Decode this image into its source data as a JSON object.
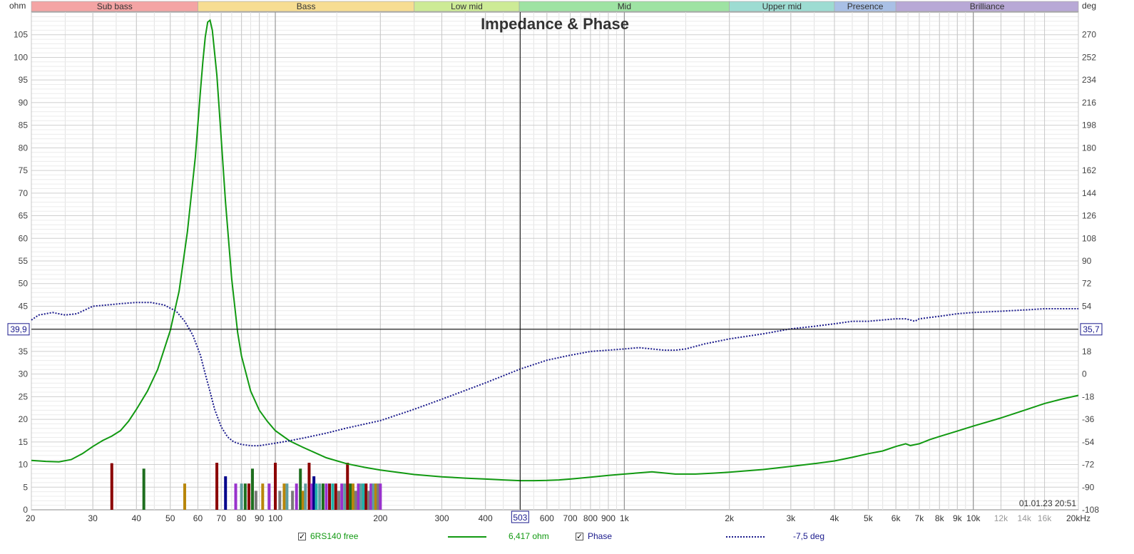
{
  "chart_data": {
    "type": "line",
    "title": "Impedance & Phase",
    "left_unit": "ohm",
    "right_unit": "deg",
    "x_scale": "log",
    "xlim": [
      20,
      20000
    ],
    "ylim_left": [
      0,
      110
    ],
    "ylim_right": [
      -108,
      288
    ],
    "x_ticks": [
      {
        "v": 20,
        "label": "20"
      },
      {
        "v": 30,
        "label": "30"
      },
      {
        "v": 40,
        "label": "40"
      },
      {
        "v": 50,
        "label": "50"
      },
      {
        "v": 60,
        "label": "60"
      },
      {
        "v": 70,
        "label": "70"
      },
      {
        "v": 80,
        "label": "80"
      },
      {
        "v": 90,
        "label": "90"
      },
      {
        "v": 100,
        "label": "100"
      },
      {
        "v": 200,
        "label": "200"
      },
      {
        "v": 300,
        "label": "300"
      },
      {
        "v": 400,
        "label": "400"
      },
      {
        "v": 600,
        "label": "600"
      },
      {
        "v": 700,
        "label": "700"
      },
      {
        "v": 800,
        "label": "800"
      },
      {
        "v": 900,
        "label": "900"
      },
      {
        "v": 1000,
        "label": "1k"
      },
      {
        "v": 2000,
        "label": "2k"
      },
      {
        "v": 3000,
        "label": "3k"
      },
      {
        "v": 4000,
        "label": "4k"
      },
      {
        "v": 5000,
        "label": "5k"
      },
      {
        "v": 6000,
        "label": "6k"
      },
      {
        "v": 7000,
        "label": "7k"
      },
      {
        "v": 8000,
        "label": "8k"
      },
      {
        "v": 9000,
        "label": "9k"
      },
      {
        "v": 10000,
        "label": "10k"
      },
      {
        "v": 12000,
        "label": "12k"
      },
      {
        "v": 14000,
        "label": "14k"
      },
      {
        "v": 16000,
        "label": "16k"
      },
      {
        "v": 20000,
        "label": "20kHz"
      }
    ],
    "y_left_ticks": [
      0,
      5,
      10,
      15,
      20,
      25,
      30,
      35,
      40,
      45,
      50,
      55,
      60,
      65,
      70,
      75,
      80,
      85,
      90,
      95,
      100,
      105
    ],
    "y_right_ticks": [
      -108,
      -90,
      -72,
      -54,
      -36,
      -18,
      0,
      18,
      36,
      54,
      72,
      90,
      108,
      126,
      144,
      162,
      180,
      198,
      216,
      234,
      252,
      270
    ],
    "bands": [
      {
        "label": "Sub bass",
        "from": 20,
        "to": 60,
        "color": "#f4a4a4"
      },
      {
        "label": "Bass",
        "from": 60,
        "to": 250,
        "color": "#f7dd92"
      },
      {
        "label": "Low mid",
        "from": 250,
        "to": 500,
        "color": "#cdeb96"
      },
      {
        "label": "Mid",
        "from": 500,
        "to": 2000,
        "color": "#9ee3a3"
      },
      {
        "label": "Upper mid",
        "from": 2000,
        "to": 4000,
        "color": "#9ddcd2"
      },
      {
        "label": "Presence",
        "from": 4000,
        "to": 6000,
        "color": "#a9c0e6"
      },
      {
        "label": "Brilliance",
        "from": 6000,
        "to": 20000,
        "color": "#b8a8d6"
      }
    ],
    "series": [
      {
        "name": "6RS140 free",
        "axis": "left",
        "color": "#119911",
        "style": "solid",
        "x": [
          20,
          22,
          24,
          26,
          28,
          30,
          32,
          34,
          36,
          38,
          40,
          43,
          46,
          50,
          53,
          56,
          59,
          61,
          62,
          63,
          64,
          65,
          66,
          68,
          70,
          72,
          75,
          78,
          80,
          85,
          90,
          95,
          100,
          110,
          120,
          140,
          160,
          180,
          200,
          250,
          300,
          350,
          400,
          450,
          503,
          550,
          600,
          650,
          700,
          800,
          900,
          1000,
          1200,
          1400,
          1600,
          1800,
          2000,
          2500,
          3000,
          3500,
          4000,
          4500,
          5000,
          5500,
          6000,
          6400,
          6600,
          6800,
          7000,
          7500,
          8000,
          9000,
          10000,
          12000,
          14000,
          16000,
          18000,
          20000
        ],
        "y": [
          10.9,
          10.7,
          10.6,
          11.1,
          12.4,
          14.0,
          15.3,
          16.3,
          17.5,
          19.6,
          22.2,
          26.2,
          31.0,
          39.6,
          48.3,
          61.5,
          78.0,
          92.5,
          99.0,
          104.5,
          107.8,
          108.2,
          106.0,
          96.0,
          82.0,
          68.0,
          51.0,
          39.2,
          34.0,
          26.2,
          22.0,
          19.5,
          17.5,
          15.2,
          13.8,
          11.5,
          10.2,
          9.4,
          8.8,
          7.8,
          7.3,
          7.0,
          6.8,
          6.6,
          6.45,
          6.45,
          6.5,
          6.6,
          6.8,
          7.2,
          7.6,
          7.9,
          8.4,
          7.9,
          7.9,
          8.1,
          8.3,
          8.9,
          9.6,
          10.2,
          10.8,
          11.6,
          12.4,
          13.0,
          14.0,
          14.6,
          14.2,
          14.4,
          14.6,
          15.5,
          16.2,
          17.4,
          18.5,
          20.3,
          22.0,
          23.5,
          24.5,
          25.3
        ]
      },
      {
        "name": "Phase",
        "axis": "right",
        "color": "#1a1a8c",
        "style": "dotted",
        "x": [
          20,
          21,
          23,
          25,
          27,
          30,
          33,
          36,
          40,
          44,
          48,
          52,
          55,
          58,
          61,
          63,
          65,
          67,
          70,
          73,
          76,
          80,
          85,
          90,
          95,
          100,
          110,
          120,
          140,
          160,
          200,
          250,
          300,
          400,
          503,
          600,
          700,
          800,
          900,
          1000,
          1100,
          1200,
          1300,
          1400,
          1500,
          1700,
          2000,
          2500,
          3000,
          3500,
          4000,
          4500,
          5000,
          5500,
          6000,
          6400,
          6600,
          6800,
          7000,
          7500,
          8000,
          9000,
          10000,
          12000,
          14000,
          16000,
          18000,
          20000
        ],
        "y": [
          43,
          47,
          49,
          47,
          48,
          54,
          55,
          56,
          57,
          57,
          55,
          50,
          42,
          31,
          15,
          0,
          -14,
          -28,
          -42,
          -50,
          -54,
          -56,
          -57,
          -57,
          -56,
          -55,
          -53,
          -51,
          -47,
          -43,
          -37,
          -28,
          -20,
          -7,
          4,
          11,
          15,
          18,
          19,
          20,
          21,
          20,
          19,
          19,
          20,
          24,
          28,
          32,
          36,
          38,
          40,
          42,
          42,
          43,
          44,
          44,
          43,
          42,
          44,
          45,
          46,
          48,
          49,
          50,
          51,
          52,
          52,
          52
        ]
      }
    ],
    "bars_x": [
      34,
      42,
      55,
      68,
      72,
      77,
      80,
      82,
      84,
      86,
      88,
      92,
      96,
      100,
      103,
      106,
      108,
      112,
      115,
      118,
      120,
      122,
      125,
      127,
      129,
      131,
      134,
      137,
      140,
      143,
      146,
      149,
      152,
      155,
      158,
      161,
      164,
      167,
      170,
      173,
      176,
      179,
      182,
      185,
      188,
      191,
      194,
      197,
      200
    ],
    "bars_y": [
      10.3,
      9.1,
      5.8,
      10.4,
      7.4,
      5.8,
      5.8,
      5.8,
      5.8,
      9.1,
      4.2,
      5.8,
      5.8,
      10.4,
      4.2,
      5.8,
      5.8,
      4.2,
      5.8,
      9.1,
      4.2,
      5.8,
      10.4,
      5.8,
      7.4,
      5.8,
      5.8,
      5.8,
      5.8,
      5.8,
      5.8,
      5.8,
      4.2,
      5.8,
      5.8,
      10.4,
      5.8,
      5.8,
      4.2,
      5.8,
      5.8,
      5.8,
      5.8,
      4.2,
      5.8,
      5.8,
      5.8,
      5.8,
      5.8
    ],
    "bars_colors": [
      "#8b0000",
      "#1e6e1e",
      "#b8860b",
      "#8b0000",
      "#00008b",
      "#9932cc",
      "#5f9ea0",
      "#1e6e1e",
      "#8b0000",
      "#1e6e1e",
      "#7a7a7a",
      "#b8860b",
      "#9932cc",
      "#8b0000",
      "#7a7a7a",
      "#b8860b",
      "#5f9ea0",
      "#7a7a7a",
      "#9932cc",
      "#1e6e1e",
      "#b8860b",
      "#5f9ea0",
      "#8b0000",
      "#9932cc",
      "#00008b",
      "#20b2aa",
      "#5f9ea0",
      "#1e6e1e",
      "#9932cc",
      "#8b0000",
      "#20b2aa",
      "#8b0000",
      "#7a7a7a",
      "#9932cc",
      "#5f9ea0",
      "#8b0000",
      "#1e6e1e",
      "#b8860b",
      "#7a7a7a",
      "#9932cc",
      "#5f9ea0",
      "#20b2aa",
      "#8b0000",
      "#7a7a7a",
      "#9932cc",
      "#5f9ea0",
      "#b8860b",
      "#7a7a7a",
      "#9932cc"
    ],
    "cursor": {
      "x": 503,
      "y_ohm": 39.9,
      "x_label": "503",
      "left_label": "39,9",
      "right_label": "35,7"
    }
  },
  "timestamp": "01.01.23 20:51",
  "legend": {
    "series1_label": "6RS140 free",
    "series1_value": "6,417 ohm",
    "series2_label": "Phase",
    "series2_value": "-7,5 deg",
    "check": "✓"
  }
}
